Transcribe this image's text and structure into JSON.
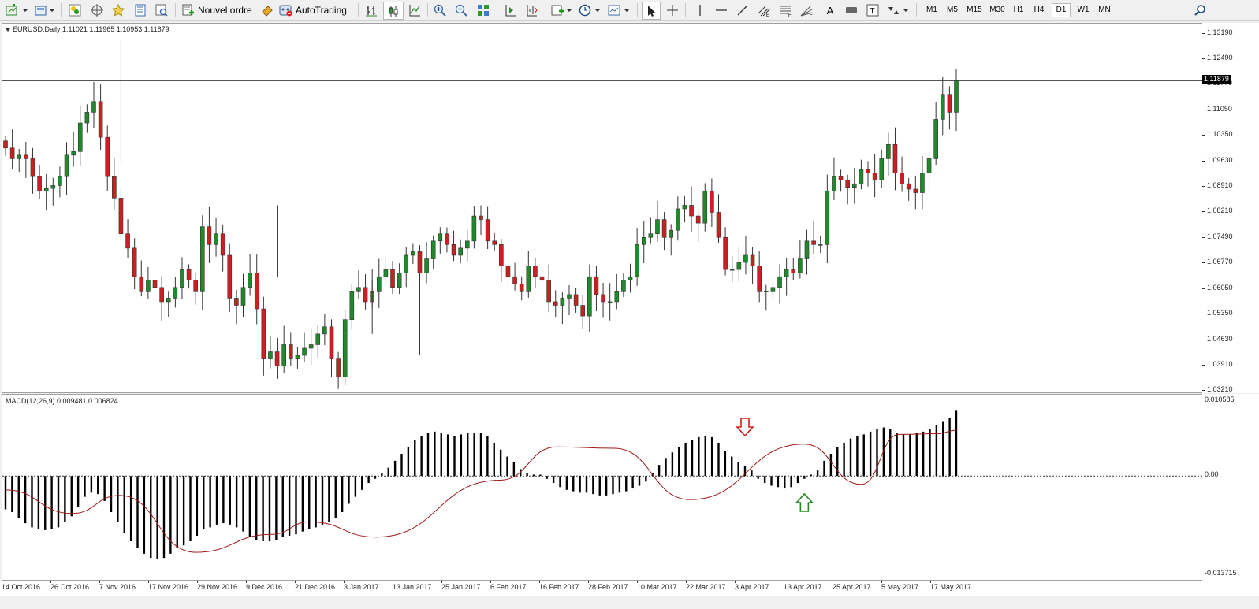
{
  "toolbar": {
    "new_order_label": "Nouvel ordre",
    "autotrading_label": "AutoTrading",
    "timeframes": [
      "M1",
      "M5",
      "M15",
      "M30",
      "H1",
      "H4",
      "D1",
      "W1",
      "MN"
    ],
    "active_timeframe": "D1",
    "icons": [
      "new-chart-icon",
      "profiles-icon",
      "market-watch-icon",
      "navigator-icon",
      "favorites-icon",
      "data-window-icon",
      "strategy-tester-icon",
      "new-order-icon",
      "autotrading-icon",
      "bar-chart-icon",
      "candlestick-icon",
      "line-chart-icon",
      "zoom-in-icon",
      "zoom-out-icon",
      "tile-windows-icon",
      "chart-shift-icon",
      "autoscroll-icon",
      "indicators-icon",
      "periodicity-icon",
      "templates-icon",
      "cursor-icon",
      "crosshair-icon",
      "vertical-line-icon",
      "horizontal-line-icon",
      "trendline-icon",
      "equidistant-channel-icon",
      "fibonacci-icon",
      "fibonacci-fan-icon",
      "text-icon",
      "rectangle-icon",
      "text-label-icon",
      "arrows-icon",
      "search-icon"
    ]
  },
  "price_panel": {
    "title": "EURUSD,Daily  1.11021 1.11965 1.10953 1.11879",
    "current_price": "1.11879",
    "bg": "#ffffff",
    "bull_color": "#1f8a2a",
    "bear_color": "#cc1f1f"
  },
  "macd_panel": {
    "title": "MACD(12,26,9) 0.009481 0.006824",
    "signal_color": "#a01818",
    "histogram_color": "#000000",
    "arrow_down_color": "#d42020",
    "arrow_up_color": "#1e8a1e"
  },
  "chart_data": [
    {
      "type": "candlestick",
      "title": "EURUSD,Daily",
      "ohlc_readout": [
        1.11021,
        1.11965,
        1.10953,
        1.11879
      ],
      "ylim": [
        1.0321,
        1.1319
      ],
      "y_ticks": [
        "1.13190",
        "1.12490",
        "1.11770",
        "1.11050",
        "1.10350",
        "1.09630",
        "1.08910",
        "1.08210",
        "1.07490",
        "1.06770",
        "1.06050",
        "1.05350",
        "1.04630",
        "1.03910",
        "1.03210"
      ],
      "x_ticks": [
        "14 Oct 2016",
        "26 Oct 2016",
        "7 Nov 2016",
        "17 Nov 2016",
        "29 Nov 2016",
        "9 Dec 2016",
        "21 Dec 2016",
        "3 Jan 2017",
        "13 Jan 2017",
        "25 Jan 2017",
        "6 Feb 2017",
        "16 Feb 2017",
        "28 Feb 2017",
        "10 Mar 2017",
        "22 Mar 2017",
        "3 Apr 2017",
        "13 Apr 2017",
        "25 Apr 2017",
        "5 May 2017",
        "17 May 2017"
      ],
      "close_path": [
        1.1,
        1.097,
        1.098,
        1.097,
        1.092,
        1.088,
        1.0887,
        1.0895,
        1.092,
        1.098,
        1.099,
        1.107,
        1.11,
        1.113,
        1.103,
        1.092,
        1.086,
        1.076,
        1.072,
        1.064,
        1.06,
        1.063,
        1.061,
        1.057,
        1.058,
        1.061,
        1.066,
        1.063,
        1.06,
        1.078,
        1.073,
        1.076,
        1.07,
        1.058,
        1.056,
        1.061,
        1.065,
        1.055,
        1.041,
        1.043,
        1.039,
        1.045,
        1.041,
        1.042,
        1.044,
        1.045,
        1.048,
        1.05,
        1.041,
        1.036,
        1.052,
        1.06,
        1.061,
        1.057,
        1.06,
        1.064,
        1.066,
        1.061,
        1.065,
        1.07,
        1.071,
        1.065,
        1.069,
        1.074,
        1.076,
        1.073,
        1.07,
        1.072,
        1.074,
        1.081,
        1.08,
        1.074,
        1.073,
        1.067,
        1.064,
        1.062,
        1.06,
        1.067,
        1.064,
        1.063,
        1.057,
        1.056,
        1.058,
        1.059,
        1.056,
        1.053,
        1.064,
        1.059,
        1.057,
        1.057,
        1.06,
        1.063,
        1.064,
        1.073,
        1.075,
        1.076,
        1.08,
        1.075,
        1.077,
        1.083,
        1.084,
        1.081,
        1.079,
        1.088,
        1.082,
        1.075,
        1.066,
        1.066,
        1.068,
        1.07,
        1.067,
        1.06,
        1.06,
        1.061,
        1.064,
        1.066,
        1.065,
        1.069,
        1.074,
        1.073,
        1.073,
        1.088,
        1.092,
        1.091,
        1.089,
        1.09,
        1.094,
        1.093,
        1.091,
        1.097,
        1.101,
        1.093,
        1.09,
        1.0885,
        1.0875,
        1.093,
        1.097,
        1.108,
        1.115,
        1.11,
        1.1188
      ],
      "wicks": [
        [
          "4",
          1.113
        ],
        [
          "20",
          1.072
        ],
        [
          "52",
          1.05
        ],
        [
          "24",
          1.065
        ]
      ],
      "candle_count": 150
    },
    {
      "type": "bar",
      "title": "MACD(12,26,9)",
      "values_readout": [
        0.009481,
        0.006824
      ],
      "ylim": [
        -0.013715,
        0.010585
      ],
      "y_ticks": [
        "0.010585",
        "0.00",
        "-0.013715"
      ],
      "histogram": [
        -0.0048,
        -0.0052,
        -0.006,
        -0.0068,
        -0.0074,
        -0.0076,
        -0.0078,
        -0.0077,
        -0.0074,
        -0.0066,
        -0.0058,
        -0.0044,
        -0.003,
        -0.0024,
        -0.0026,
        -0.0036,
        -0.0052,
        -0.0066,
        -0.0082,
        -0.0094,
        -0.0104,
        -0.0112,
        -0.0118,
        -0.012,
        -0.0118,
        -0.0112,
        -0.0104,
        -0.01,
        -0.0094,
        -0.0086,
        -0.0076,
        -0.0074,
        -0.007,
        -0.0068,
        -0.007,
        -0.0074,
        -0.008,
        -0.0088,
        -0.0092,
        -0.0094,
        -0.0094,
        -0.0092,
        -0.0088,
        -0.0086,
        -0.0084,
        -0.008,
        -0.0076,
        -0.0074,
        -0.007,
        -0.0066,
        -0.006,
        -0.0052,
        -0.004,
        -0.003,
        -0.002,
        -0.001,
        -0.0004,
        0.0004,
        0.0012,
        0.0022,
        0.0032,
        0.0042,
        0.0052,
        0.0058,
        0.0062,
        0.0064,
        0.0062,
        0.006,
        0.0058,
        0.006,
        0.0062,
        0.0062,
        0.0062,
        0.0058,
        0.0048,
        0.0038,
        0.0028,
        0.002,
        0.001,
        0.0004,
        0.0002,
        0.0002,
        -0.0004,
        -0.001,
        -0.0016,
        -0.002,
        -0.0022,
        -0.0024,
        -0.0024,
        -0.0026,
        -0.0028,
        -0.0028,
        -0.0026,
        -0.0024,
        -0.0022,
        -0.0018,
        -0.0014,
        -0.0008,
        0.0004,
        0.0016,
        0.0026,
        0.0034,
        0.0042,
        0.0048,
        0.0052,
        0.0056,
        0.0058,
        0.0056,
        0.0048,
        0.0036,
        0.0028,
        0.002,
        0.0014,
        0.0008,
        -0.0004,
        -0.001,
        -0.0014,
        -0.0016,
        -0.0018,
        -0.0016,
        -0.001,
        -0.0004,
        0.0002,
        0.0008,
        0.0022,
        0.0032,
        0.0042,
        0.0048,
        0.0054,
        0.0058,
        0.006,
        0.0064,
        0.0068,
        0.007,
        0.0068,
        0.0062,
        0.006,
        0.006,
        0.0062,
        0.0064,
        0.0068,
        0.0074,
        0.0078,
        0.0084,
        0.0094
      ],
      "signal_knots": [
        [
          0,
          -0.002
        ],
        [
          14,
          -0.0054
        ],
        [
          24,
          -0.0028
        ],
        [
          40,
          -0.011
        ],
        [
          56,
          -0.0084
        ],
        [
          64,
          -0.0066
        ],
        [
          78,
          -0.0088
        ],
        [
          104,
          -0.0006
        ],
        [
          116,
          0.0042
        ],
        [
          128,
          0.004
        ],
        [
          144,
          -0.0034
        ],
        [
          168,
          0.0046
        ],
        [
          180,
          -0.0012
        ],
        [
          188,
          0.006
        ],
        [
          196,
          0.0061
        ],
        [
          200,
          0.0066
        ]
      ],
      "annotations": [
        {
          "type": "arrow-down",
          "at_index": 112
        },
        {
          "type": "arrow-up",
          "at_index": 121
        }
      ]
    }
  ]
}
